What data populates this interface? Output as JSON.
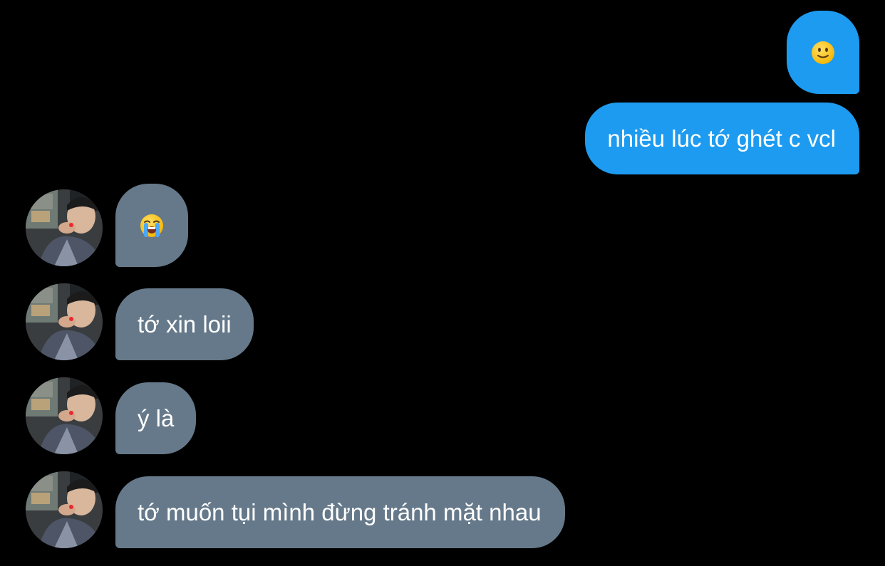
{
  "conversation": {
    "colors": {
      "background": "#000000",
      "sent_bubble": "#1d9bf0",
      "received_bubble": "#66798a",
      "text": "#ffffff"
    },
    "messages": [
      {
        "sender": "me",
        "type": "emoji",
        "icon": "slightly-smiling-face-icon"
      },
      {
        "sender": "me",
        "type": "text",
        "text": "nhiều lúc tớ ghét c vcl"
      },
      {
        "sender": "other",
        "type": "emoji",
        "icon": "loudly-crying-face-icon"
      },
      {
        "sender": "other",
        "type": "text",
        "text": "tớ xin loii"
      },
      {
        "sender": "other",
        "type": "text",
        "text": "ý là"
      },
      {
        "sender": "other",
        "type": "text",
        "text": "tớ muốn tụi mình đừng tránh mặt nhau"
      }
    ]
  }
}
